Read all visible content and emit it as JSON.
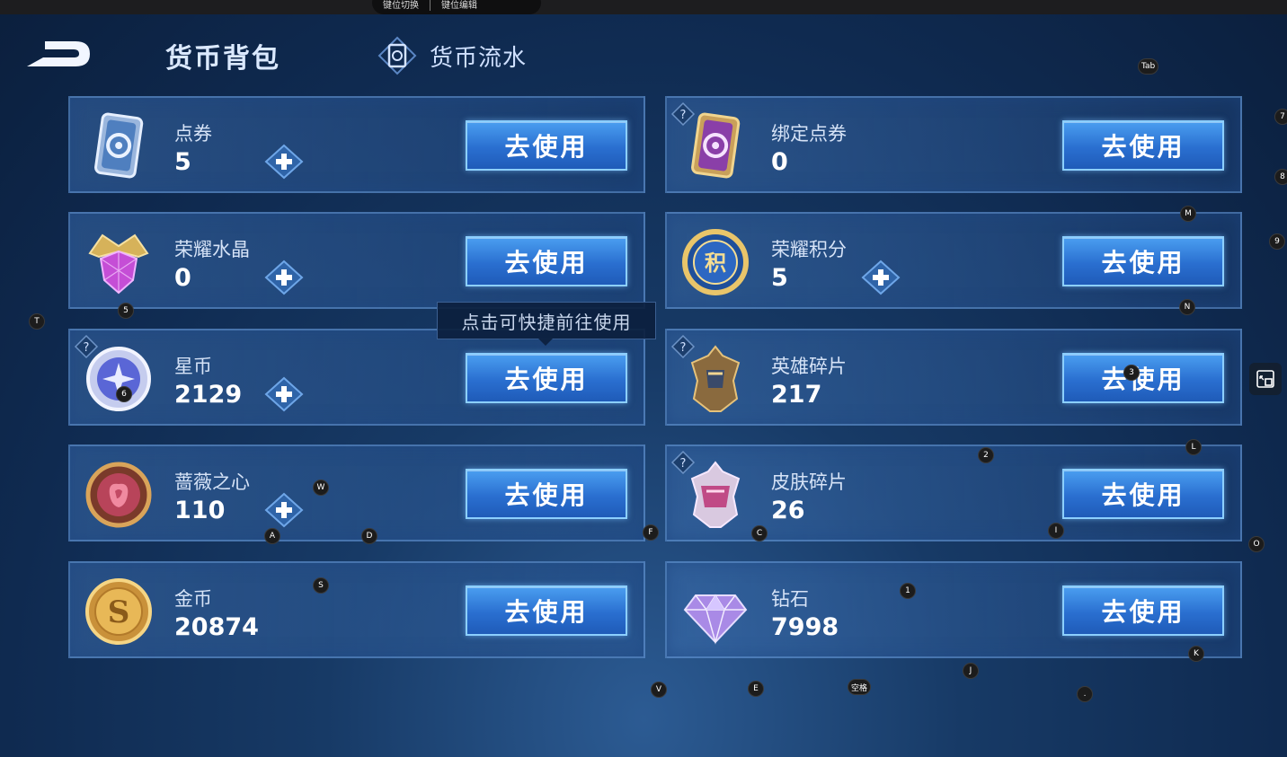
{
  "top_bar": {
    "left_text": "键位切换",
    "right_text": "键位编辑"
  },
  "header": {
    "title": "货币背包",
    "flow_label": "货币流水"
  },
  "use_label": "去使用",
  "tooltip": "点击可快捷前往使用",
  "currencies": [
    {
      "name": "点券",
      "amount": "5"
    },
    {
      "name": "绑定点券",
      "amount": "0"
    },
    {
      "name": "荣耀水晶",
      "amount": "0"
    },
    {
      "name": "荣耀积分",
      "amount": "5"
    },
    {
      "name": "星币",
      "amount": "2129"
    },
    {
      "name": "英雄碎片",
      "amount": "217"
    },
    {
      "name": "蔷薇之心",
      "amount": "110"
    },
    {
      "name": "皮肤碎片",
      "amount": "26"
    },
    {
      "name": "金币",
      "amount": "20874"
    },
    {
      "name": "钻石",
      "amount": "7998"
    }
  ],
  "key_hints": [
    "Tab",
    "7",
    "8",
    "M",
    "9",
    "N",
    "T",
    "5",
    "6",
    "3",
    "2",
    "L",
    "W",
    "A",
    "D",
    "F",
    "C",
    "I",
    "O",
    "S",
    "1",
    "K",
    "J",
    "V",
    "E",
    "空格",
    "."
  ],
  "colors": {
    "button": "#2a6fd0",
    "button_border": "#8ccfff",
    "background": "#173a66"
  }
}
